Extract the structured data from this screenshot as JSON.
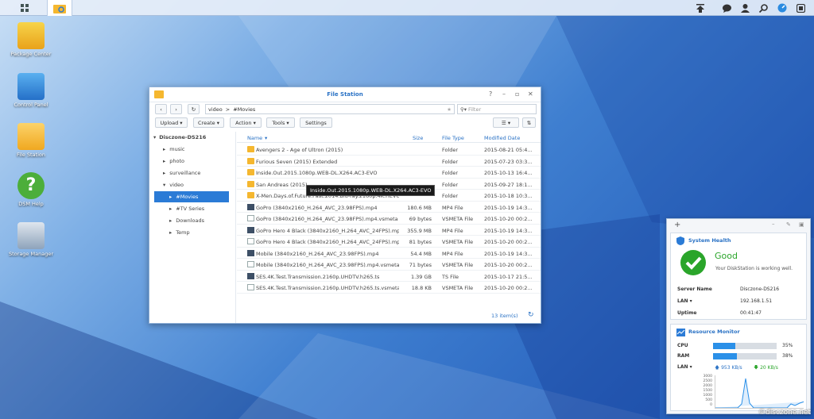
{
  "desktop": {
    "icons": [
      {
        "label": "Package Center"
      },
      {
        "label": "Control Panel"
      },
      {
        "label": "File Station"
      },
      {
        "label": "DSM Help"
      },
      {
        "label": "Storage Manager"
      }
    ]
  },
  "window": {
    "title": "File Station",
    "path": {
      "root": "video",
      "sep": ">",
      "current": "#Movies"
    },
    "filter_placeholder": "Filter",
    "toolbar": {
      "upload": "Upload",
      "create": "Create",
      "action": "Action",
      "tools": "Tools",
      "settings": "Settings"
    },
    "tree": {
      "root": "Disczone-DS216",
      "items": [
        "music",
        "photo",
        "surveillance",
        "video",
        "#Movies",
        "#TV Series",
        "Downloads",
        "Temp"
      ]
    },
    "columns": {
      "name": "Name",
      "size": "Size",
      "type": "File Type",
      "modified": "Modified Date"
    },
    "rows": [
      {
        "name": "Avengers 2 - Age of Ultron (2015)",
        "size": "",
        "type": "Folder",
        "date": "2015-08-21 05:4..."
      },
      {
        "name": "Furious Seven (2015) Extended",
        "size": "",
        "type": "Folder",
        "date": "2015-07-23 03:3..."
      },
      {
        "name": "Inside.Out.2015.1080p.WEB-DL.X264.AC3-EVO",
        "size": "",
        "type": "Folder",
        "date": "2015-10-13 16:4..."
      },
      {
        "name": "San Andreas (2015)",
        "size": "",
        "type": "Folder",
        "date": "2015-09-27 18:1..."
      },
      {
        "name": "X-Men.Days.of.Future.Past.2014.Blu-ray.2160p.4K.HEVC...",
        "size": "",
        "type": "Folder",
        "date": "2015-10-18 10:3..."
      },
      {
        "name": "GoPro (3840x2160_H.264_AVC_23.98FPS).mp4",
        "size": "180.6 MB",
        "type": "MP4 File",
        "date": "2015-10-19 14:3..."
      },
      {
        "name": "GoPro (3840x2160_H.264_AVC_23.98FPS).mp4.vsmeta",
        "size": "69 bytes",
        "type": "VSMETA File",
        "date": "2015-10-20 00:2..."
      },
      {
        "name": "GoPro Hero 4 Black (3840x2160_H.264_AVC_24FPS).mp4",
        "size": "355.9 MB",
        "type": "MP4 File",
        "date": "2015-10-19 14:3..."
      },
      {
        "name": "GoPro Hero 4 Black (3840x2160_H.264_AVC_24FPS).mp...",
        "size": "81 bytes",
        "type": "VSMETA File",
        "date": "2015-10-20 00:2..."
      },
      {
        "name": "Mobile (3840x2160_H.264_AVC_23.98FPS).mp4",
        "size": "54.4 MB",
        "type": "MP4 File",
        "date": "2015-10-19 14:3..."
      },
      {
        "name": "Mobile (3840x2160_H.264_AVC_23.98FPS).mp4.vsmeta",
        "size": "71 bytes",
        "type": "VSMETA File",
        "date": "2015-10-20 00:2..."
      },
      {
        "name": "SES.4K.Test.Transmission.2160p.UHDTV.h265.ts",
        "size": "1.39 GB",
        "type": "TS File",
        "date": "2015-10-17 21:5..."
      },
      {
        "name": "SES.4K.Test.Transmission.2160p.UHDTV.h265.ts.vsmeta",
        "size": "18.8 KB",
        "type": "VSMETA File",
        "date": "2015-10-20 00:2..."
      }
    ],
    "row_kinds": [
      "folder",
      "folder",
      "folder",
      "folder",
      "folder",
      "video",
      "file",
      "video",
      "file",
      "video",
      "file",
      "video",
      "file"
    ],
    "item_count": "13 item(s)",
    "tooltip": "Inside.Out.2015.1080p.WEB-DL.X264.AC3-EVO"
  },
  "health": {
    "title": "System Health",
    "status": "Good",
    "message": "Your DiskStation is working well.",
    "server_label": "Server Name",
    "server": "Disczone-DS216",
    "lan_label": "LAN",
    "lan": "192.168.1.51",
    "uptime_label": "Uptime",
    "uptime": "00:41:47"
  },
  "monitor": {
    "title": "Resource Monitor",
    "cpu_label": "CPU",
    "cpu": "35%",
    "cpu_value": 0.35,
    "ram_label": "RAM",
    "ram": "38%",
    "ram_value": 0.38,
    "lan_label": "LAN",
    "up": "953 KB/s",
    "down": "20 KB/s",
    "yticks": [
      "3000",
      "2500",
      "2000",
      "1500",
      "1000",
      "500",
      "0"
    ]
  },
  "watermark": "©disczone.net",
  "colors": {
    "accent": "#2b7bd6",
    "good": "#2aa52a"
  }
}
